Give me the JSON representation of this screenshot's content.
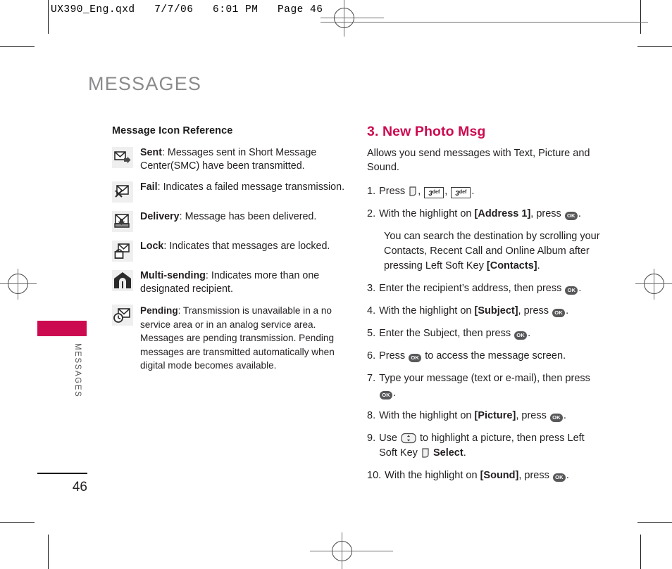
{
  "printer_slug": "UX390_Eng.qxd   7/7/06   6:01 PM   Page 46",
  "running_head": "MESSAGES",
  "margin_tab": {
    "label": "MESSAGES",
    "bar_color": "#cc0a50"
  },
  "folio": "46",
  "left_column": {
    "subhead": "Message Icon Reference",
    "items": [
      {
        "icon": "sent-message-icon",
        "term": "Sent",
        "description": ": Messages sent in Short Message Center(SMC) have been transmitted."
      },
      {
        "icon": "failed-message-icon",
        "term": "Fail",
        "description": ": Indicates a failed message transmission."
      },
      {
        "icon": "delivered-message-icon",
        "term": "Delivery",
        "description": ": Message has been delivered."
      },
      {
        "icon": "locked-message-icon",
        "term": "Lock",
        "description": ": Indicates that messages are locked."
      },
      {
        "icon": "multi-sending-icon",
        "term": "Multi-sending",
        "description": ": Indicates more than one designated recipient."
      },
      {
        "icon": "pending-message-icon",
        "term": "Pending",
        "description": ": Transmission is unavailable in a no service area or in an analog service area. Messages are pending transmission. Pending messages are transmitted automatically when digital mode becomes available.",
        "small": true
      }
    ]
  },
  "right_column": {
    "section_heading": "3. New Photo Msg",
    "heading_color": "#cc0a50",
    "intro": "Allows you send messages with Text, Picture and Sound.",
    "steps": [
      {
        "num": "1.",
        "parts": [
          {
            "type": "text",
            "value": "Press "
          },
          {
            "type": "key-soft"
          },
          {
            "type": "text",
            "value": ", "
          },
          {
            "type": "key-num",
            "digit": "3",
            "letters": "def"
          },
          {
            "type": "text",
            "value": ", "
          },
          {
            "type": "key-num",
            "digit": "3",
            "letters": "def"
          },
          {
            "type": "text",
            "value": "."
          }
        ]
      },
      {
        "num": "2.",
        "parts": [
          {
            "type": "text",
            "value": "With the highlight on "
          },
          {
            "type": "bold",
            "value": "[Address 1]"
          },
          {
            "type": "text",
            "value": ", press "
          },
          {
            "type": "key-ok",
            "value": "OK"
          },
          {
            "type": "text",
            "value": "."
          }
        ]
      },
      {
        "num": "3.",
        "parts": [
          {
            "type": "text",
            "value": "Enter the recipient’s address, then press "
          },
          {
            "type": "key-ok",
            "value": "OK"
          },
          {
            "type": "text",
            "value": "."
          }
        ]
      },
      {
        "num": "4.",
        "parts": [
          {
            "type": "text",
            "value": "With the highlight on "
          },
          {
            "type": "bold",
            "value": "[Subject]"
          },
          {
            "type": "text",
            "value": ", press "
          },
          {
            "type": "key-ok",
            "value": "OK"
          },
          {
            "type": "text",
            "value": "."
          }
        ]
      },
      {
        "num": "5.",
        "parts": [
          {
            "type": "text",
            "value": "Enter the Subject, then press "
          },
          {
            "type": "key-ok",
            "value": "OK"
          },
          {
            "type": "text",
            "value": "."
          }
        ]
      },
      {
        "num": "6.",
        "parts": [
          {
            "type": "text",
            "value": "Press "
          },
          {
            "type": "key-ok",
            "value": "OK"
          },
          {
            "type": "text",
            "value": " to access the message screen."
          }
        ]
      },
      {
        "num": "7.",
        "parts": [
          {
            "type": "text",
            "value": "Type your message (text or e-mail), then press "
          },
          {
            "type": "key-ok",
            "value": "OK"
          },
          {
            "type": "text",
            "value": "."
          }
        ]
      },
      {
        "num": "8.",
        "parts": [
          {
            "type": "text",
            "value": "With the highlight on "
          },
          {
            "type": "bold",
            "value": "[Picture]"
          },
          {
            "type": "text",
            "value": ", press "
          },
          {
            "type": "key-ok",
            "value": "OK"
          },
          {
            "type": "text",
            "value": "."
          }
        ]
      },
      {
        "num": "9.",
        "parts": [
          {
            "type": "text",
            "value": "Use "
          },
          {
            "type": "key-nav"
          },
          {
            "type": "text",
            "value": " to highlight a picture, then press  Left Soft Key "
          },
          {
            "type": "key-soft"
          },
          {
            "type": "bold",
            "value": " Select"
          },
          {
            "type": "text",
            "value": "."
          }
        ]
      },
      {
        "num": "10.",
        "parts": [
          {
            "type": "text",
            "value": "With the highlight on "
          },
          {
            "type": "bold",
            "value": "[Sound]"
          },
          {
            "type": "text",
            "value": ", press "
          },
          {
            "type": "key-ok",
            "value": "OK"
          },
          {
            "type": "text",
            "value": "."
          }
        ]
      }
    ],
    "note_after_step2": {
      "parts": [
        {
          "type": "text",
          "value": "You can search the destination by scrolling your Contacts, Recent Call and Online Album after pressing Left Soft Key "
        },
        {
          "type": "bold",
          "value": "[Contacts]"
        },
        {
          "type": "text",
          "value": "."
        }
      ]
    }
  }
}
